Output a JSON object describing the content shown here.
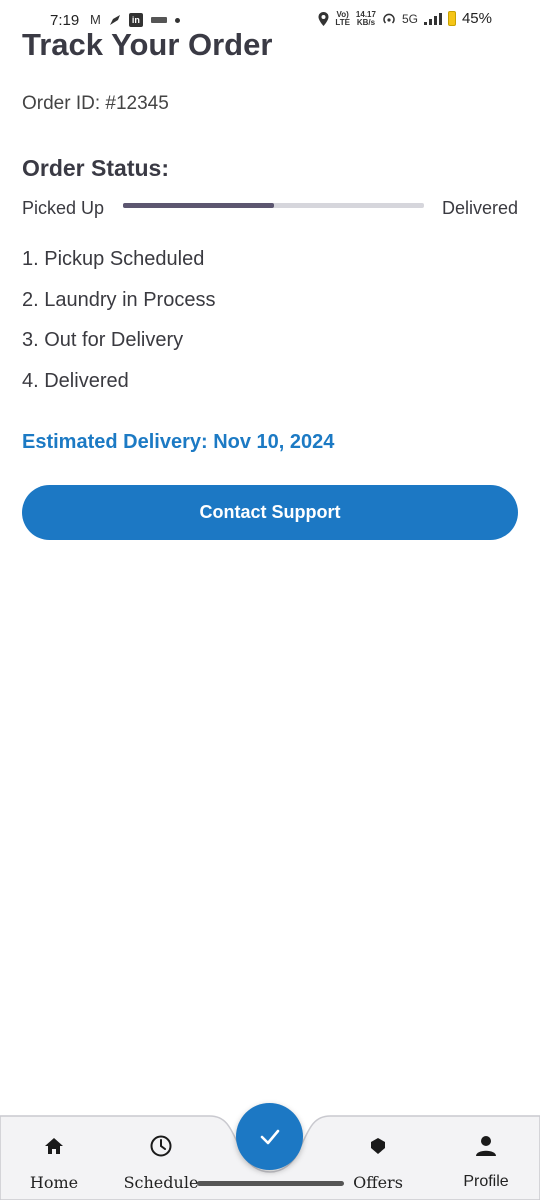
{
  "status_bar": {
    "time": "7:19",
    "network_speed_value": "14.17",
    "network_speed_unit": "KB/s",
    "network_type": "5G",
    "volte_top": "Vo)",
    "volte_bottom": "LTE",
    "battery_percent": "45%",
    "battery_color": "#f5c518",
    "icons": [
      "gmail-icon",
      "feather-icon",
      "linkedin-icon",
      "app-notification-icon",
      "dot-icon",
      "location-icon",
      "hotspot-icon",
      "signal-icon",
      "battery-icon"
    ]
  },
  "page": {
    "title": "Track Your Order",
    "order_id": "Order ID: #12345"
  },
  "order_status": {
    "heading": "Order Status:",
    "progress_start_label": "Picked Up",
    "progress_end_label": "Delivered",
    "progress_fraction": 0.5,
    "progress_color": "#5c5670",
    "track_color": "#d6d6dc",
    "steps": [
      "1. Pickup Scheduled",
      "2. Laundry in Process",
      "3. Out for Delivery",
      "4. Delivered"
    ]
  },
  "estimated_delivery": "Estimated Delivery: Nov 10, 2024",
  "contact_button_label": "Contact Support",
  "accent_color": "#1c78c4",
  "bottom_nav": {
    "items": [
      {
        "label": "Home",
        "icon": "home-icon"
      },
      {
        "label": "Schedule",
        "icon": "clock-icon"
      },
      {
        "label": "Offers",
        "icon": "tag-icon"
      },
      {
        "label": "Profile",
        "icon": "person-icon"
      }
    ],
    "fab_icon": "check-icon"
  }
}
